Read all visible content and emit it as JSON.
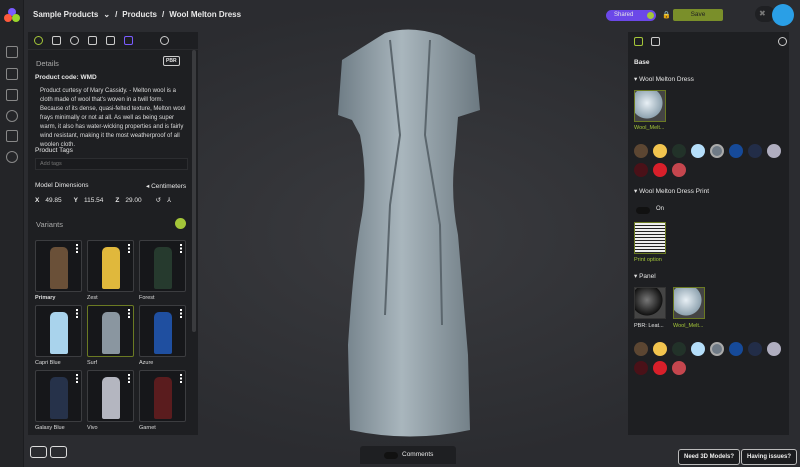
{
  "breadcrumb": {
    "project": "Sample Products",
    "section": "Products",
    "item": "Wool Melton Dress"
  },
  "header": {
    "shared_label": "Shared",
    "save_label": "Save"
  },
  "left": {
    "details_label": "Details",
    "pbr_badge": "PBR",
    "product_code": "Product code: WMD",
    "description": "Product curtesy of Mary Cassidy. - Melton wool is a cloth made of wool that's woven in a twill form. Because of its dense, quasi-felted texture, Melton wool frays minimally or not at all. As well as being super warm, it also has water-wicking properties and is fairly wind resistant, making it the most weatherproof of all woolen cloth.",
    "tags_label": "Product Tags",
    "tags_placeholder": "Add tags",
    "dims_label": "Model Dimensions",
    "units": "Centimeters",
    "x_label": "X",
    "x": "49.85",
    "y_label": "Y",
    "y": "115.54",
    "z_label": "Z",
    "z": "29.00",
    "variants_label": "Variants",
    "variants": [
      {
        "name": "Primary",
        "color": "#6a5038"
      },
      {
        "name": "Zest",
        "color": "#e0b83c"
      },
      {
        "name": "Forest",
        "color": "#263a2e"
      },
      {
        "name": "Capri Blue",
        "color": "#a9d3ec"
      },
      {
        "name": "Surf",
        "color": "#8a96a0"
      },
      {
        "name": "Azure",
        "color": "#1f4fa0"
      },
      {
        "name": "Galaxy Blue",
        "color": "#26324a"
      },
      {
        "name": "Vivo",
        "color": "#b4b6c0"
      },
      {
        "name": "Garnet",
        "color": "#5a1c1e"
      }
    ]
  },
  "right": {
    "base_label": "Base",
    "group1": "Wool Melton Dress",
    "mat1": "Wool_Melt...",
    "group2": "Wool Melton Dress Print",
    "toggle_label": "On",
    "print_label": "Print option",
    "group3": "Panel",
    "mat2": "PBR: Leat...",
    "mat3": "Wool_Melt...",
    "swatches": [
      "#5c4632",
      "#f2c44e",
      "#223229",
      "#b5defa",
      "#6f7a86",
      "#164a99",
      "#222d48",
      "#b0aec0",
      "#4a1118",
      "#d81f2a",
      "#c5464e"
    ]
  },
  "footer": {
    "comments": "Comments",
    "need_models": "Need 3D Models?",
    "issues": "Having issues?"
  },
  "accent": "#a4c639"
}
